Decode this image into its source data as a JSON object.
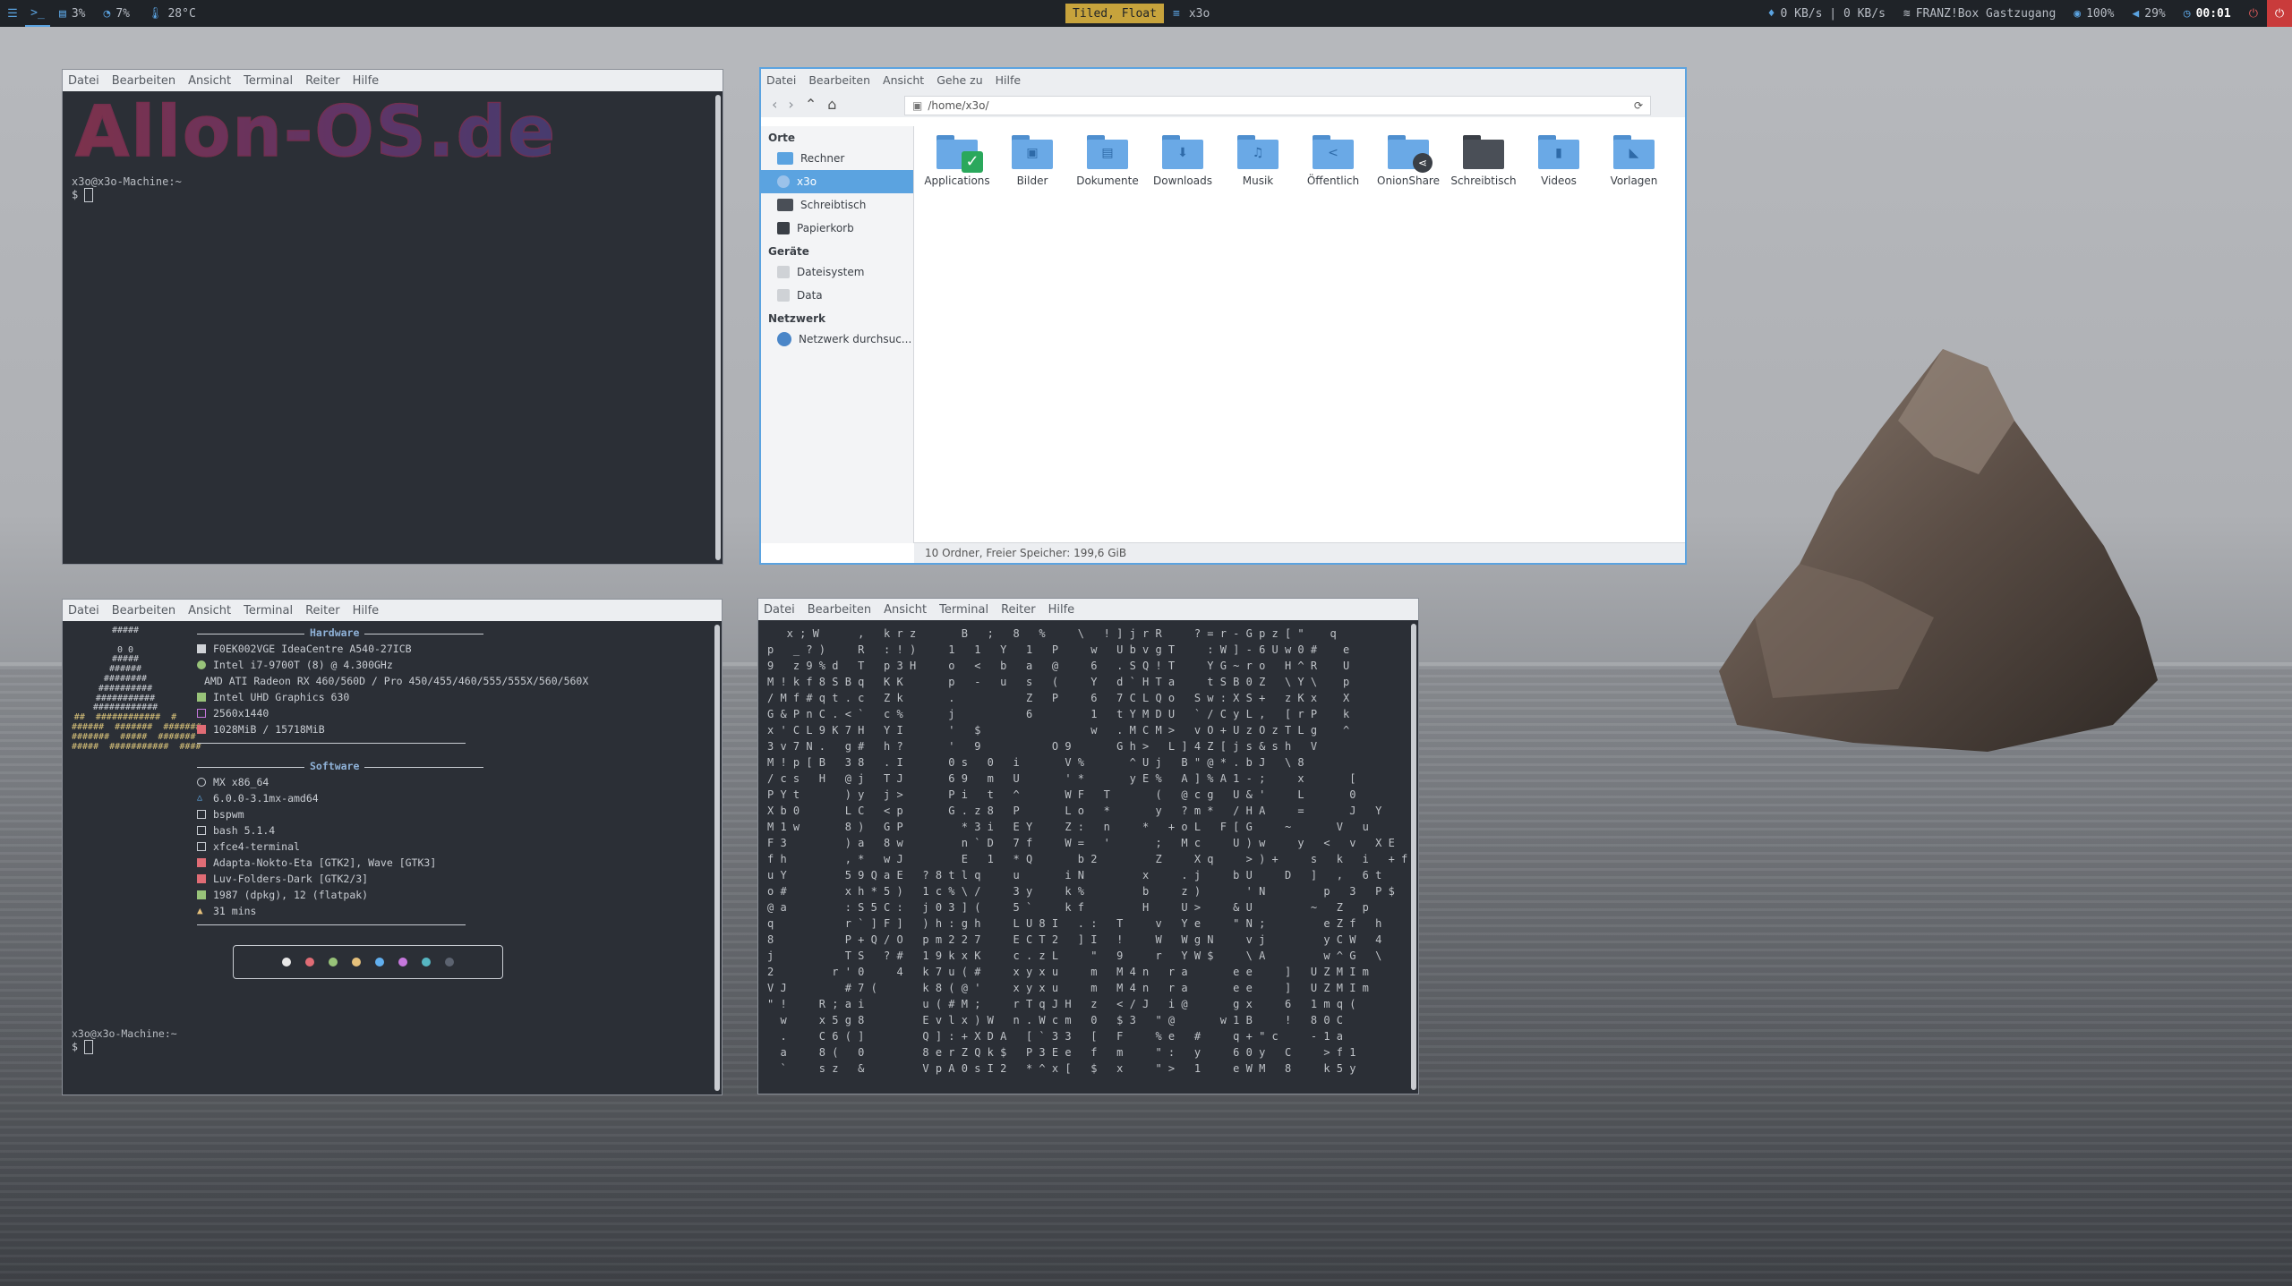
{
  "topbar": {
    "cpu": "3%",
    "mem": "7%",
    "temp": "28°C",
    "layout_mode": "Tiled, Float",
    "window_title": "x3o",
    "net": "0 KB/s | 0 KB/s",
    "wifi": "FRANZ!Box Gastzugang",
    "brightness": "100%",
    "volume": "29%",
    "clock": "00:01"
  },
  "terminal_menu": [
    "Datei",
    "Bearbeiten",
    "Ansicht",
    "Terminal",
    "Reiter",
    "Hilfe"
  ],
  "terminal1": {
    "banner": "Allon-OS.de",
    "prompt_host": "x3o@x3o-Machine:~",
    "prompt_symbol": "$"
  },
  "filemanager": {
    "menu": [
      "Datei",
      "Bearbeiten",
      "Ansicht",
      "Gehe zu",
      "Hilfe"
    ],
    "path": "/home/x3o/",
    "sections": {
      "orte": "Orte",
      "geraete": "Geräte",
      "netzwerk": "Netzwerk"
    },
    "places": [
      "Rechner",
      "x3o",
      "Schreibtisch",
      "Papierkorb"
    ],
    "devices": [
      "Dateisystem",
      "Data"
    ],
    "network": [
      "Netzwerk durchsuc..."
    ],
    "folders": [
      "Applications",
      "Bilder",
      "Dokumente",
      "Downloads",
      "Musik",
      "Öffentlich",
      "OnionShare",
      "Schreibtisch",
      "Videos",
      "Vorlagen"
    ],
    "status": "10 Ordner, Freier Speicher: 199,6 GiB"
  },
  "neofetch": {
    "hardware_title": "Hardware",
    "software_title": "Software",
    "hardware": [
      "F0EK002VGE IdeaCentre A540-27ICB",
      "Intel i7-9700T (8) @ 4.300GHz",
      "AMD ATI Radeon RX 460/560D / Pro 450/455/460/555/555X/560/560X",
      "Intel UHD Graphics 630",
      "2560x1440",
      "1028MiB / 15718MiB"
    ],
    "software": [
      "MX x86_64",
      "6.0.0-3.1mx-amd64",
      "bspwm",
      "bash 5.1.4",
      "xfce4-terminal",
      "Adapta-Nokto-Eta [GTK2], Wave [GTK3]",
      "Luv-Folders-Dark [GTK2/3]",
      "1987 (dpkg), 12 (flatpak)",
      "31 mins"
    ],
    "colors": [
      "#e8e8e8",
      "#e06c75",
      "#98c379",
      "#e5c07b",
      "#61afef",
      "#c678dd",
      "#56b6c2",
      "#5c6370"
    ],
    "prompt_host": "x3o@x3o-Machine:~",
    "prompt_symbol": "$"
  },
  "matrix_text": "   x ; W      ,   k r z       B   ;   8   %     \\   ! ] j r R     ? = r - G p z [ \"    q\np   _ ? )     R   : ! )     1   1   Y   1   P     w   U b v g T     : W ] - 6 U w 0 #    e\n9   z 9 % d   T   p 3 H     o   <   b   a   @     6   . S Q ! T     Y G ~ r o   H ^ R    U\nM ! k f 8 S B q   K K       p   -   u   s   (     Y   d ` H T a     t S B 0 Z   \\ Y \\    p\n/ M f # q t . c   Z k       .           Z   P     6   7 C L Q o   S w : X S +   z K x    X\nG & P n C . < `   c %       j           6         1   t Y M D U   ` / C y L ,   [ r P    k\nx ' C L 9 K 7 H   Y I       '   $                 w   . M C M >   v O + U z O z T L g    ^\n3 v 7 N .   g #   h ?       '   9           O 9       G h >   L ] 4 Z [ j s & s h   V\nM ! p [ B   3 8   . I       0 s   0   i       V %       ^ U j   B \" @ * . b J   \\ 8\n/ c s   H   @ j   T J       6 9   m   U       ' *       y E %   A ] % A 1 - ;     x       [\nP Y t       ) y   j >       P i   t   ^       W F   T       (   @ c g   U & '     L       0\nX b 0       L C   < p       G . z 8   P       L o   *       y   ? m *   / H A     =       J   Y\nM 1 w       8 )   G P         * 3 i   E Y     Z :   n     *   + o L   F [ G     ~       V   u\nF 3         ) a   8 w         n ` D   7 f     W =   '       ;   M c     U ) w     y   <   v   X E\nf h         , *   w J         E   1   * Q       b 2         Z     X q     > ) +     s   k   i   + f\nu Y         5 9 Q a E   ? 8 t l q     u       i N         x     . j     b U     D   ]   ,   6 t\no #         x h * 5 )   1 c % \\ /     3 y     k %         b     z )       ' N         p   3   P $\n@ a         : S 5 C :   j 0 3 ] (     5 `     k f         H     U >     & U         ~   Z   p\nq           r ` ] F ]   ) h : g h     L U 8 I   . :   T     v   Y e     \" N ;         e Z f   h\n8           P + Q / O   p m 2 2 7     E C T 2   ] I   !     W   W g N     v j         y C W   4\nj           T S   ? #   1 9 k x K     c . z L     \"   9     r   Y W $     \\ A         w ^ G   \\\n2         r ' 0     4   k 7 u ( #     x y x u     m   M 4 n   r a       e e     ]   U Z M I m\nV J         # 7 (       k 8 ( @ '     x y x u     m   M 4 n   r a       e e     ]   U Z M I m\n\" !     R ; a i         u ( # M ;     r T q J H   z   < / J   i @       g x     6   1 m q (\n  w     x 5 g 8         E v l x ) W   n . W c m   0   $ 3   \" @       w 1 B     !   8 0 C\n  .     C 6 ( ]         Q ] : + X D A   [ ` 3 3   [   F     % e   #     q + \" c     - 1 a\n  a     8 (   0         8 e r Z Q k $   P 3 E e   f   m     \" :   y     6 0 y   C     > f 1\n  `     s z   &         V p A 0 s I 2   * ^ x [   $   x     \" >   1     e W M   8     k 5 y"
}
